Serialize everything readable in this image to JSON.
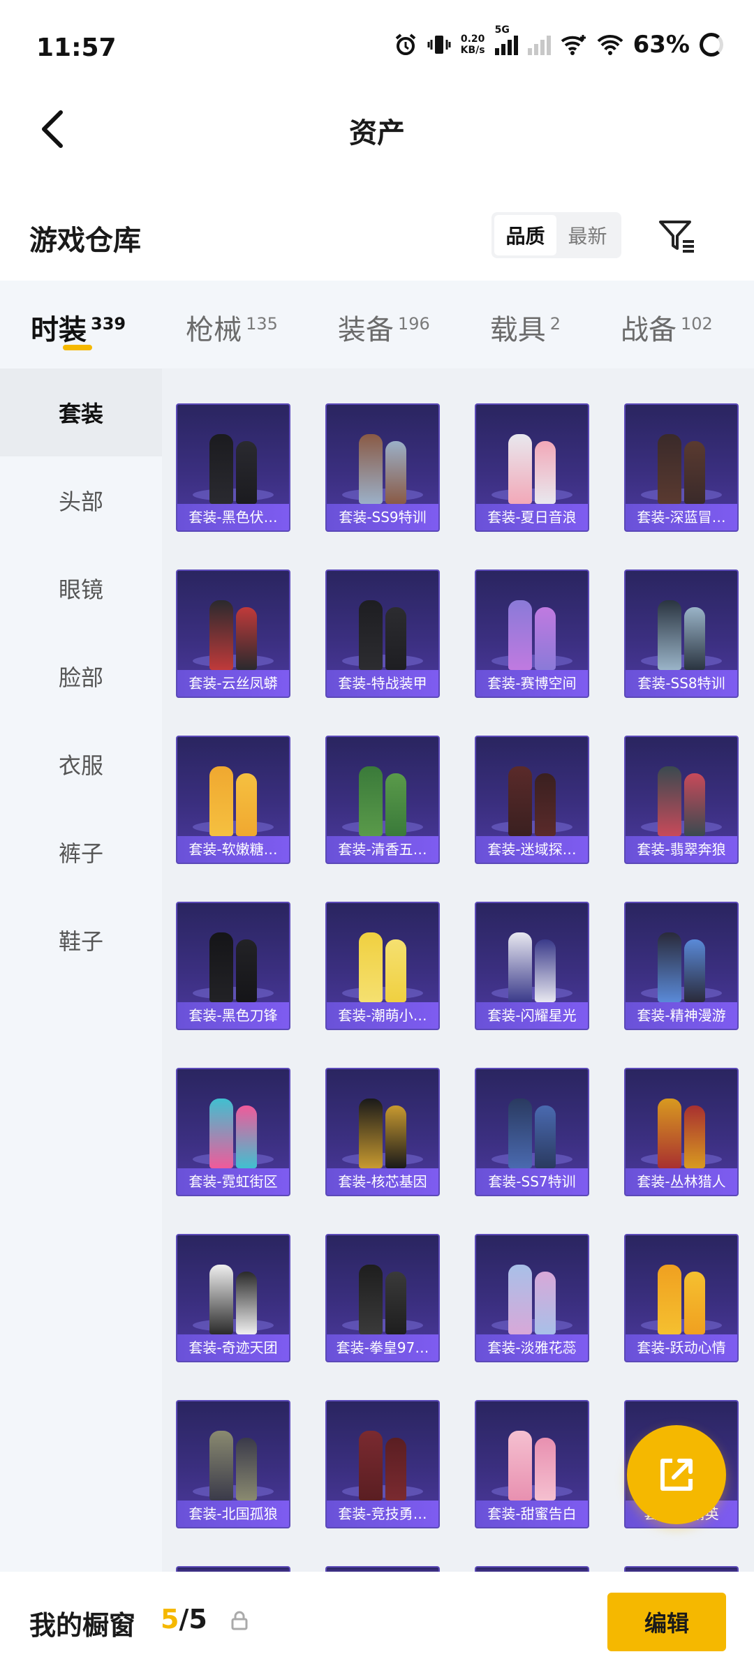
{
  "status": {
    "time": "11:57",
    "net_speed_value": "0.20",
    "net_speed_unit": "KB/s",
    "network_type": "5G",
    "battery": "63%"
  },
  "header": {
    "title": "资产"
  },
  "section": {
    "title": "游戏仓库",
    "sort_options": [
      "品质",
      "最新"
    ],
    "sort_selected": "品质"
  },
  "tabs": [
    {
      "label": "时装",
      "count": "339",
      "active": true
    },
    {
      "label": "枪械",
      "count": "135"
    },
    {
      "label": "装备",
      "count": "196"
    },
    {
      "label": "载具",
      "count": "2"
    },
    {
      "label": "战备",
      "count": "102"
    }
  ],
  "sidebar": {
    "items": [
      "套装",
      "头部",
      "眼镜",
      "脸部",
      "衣服",
      "裤子",
      "鞋子"
    ],
    "selected": "套装"
  },
  "items": [
    {
      "name": "套装-黑色伏…",
      "c1": "#1b1b1f",
      "c2": "#2a2a30"
    },
    {
      "name": "套装-SS9特训",
      "c1": "#8a5a45",
      "c2": "#9bb0c8"
    },
    {
      "name": "套装-夏日音浪",
      "c1": "#e8e8ee",
      "c2": "#f2a8b8"
    },
    {
      "name": "套装-深蓝冒…",
      "c1": "#3a2a2a",
      "c2": "#5a3a30"
    },
    {
      "name": "套装-云丝凤蟒",
      "c1": "#2a2a2e",
      "c2": "#c03a3a"
    },
    {
      "name": "套装-特战装甲",
      "c1": "#1e1e22",
      "c2": "#2c2c30"
    },
    {
      "name": "套装-赛博空间",
      "c1": "#8a7ad8",
      "c2": "#c07ae0"
    },
    {
      "name": "套装-SS8特训",
      "c1": "#2a3440",
      "c2": "#9ab4c8"
    },
    {
      "name": "套装-软嫩糖…",
      "c1": "#f0a830",
      "c2": "#f5c040"
    },
    {
      "name": "套装-清香五…",
      "c1": "#3a7a3a",
      "c2": "#5a9a4a"
    },
    {
      "name": "套装-迷域探…",
      "c1": "#5a2a2a",
      "c2": "#3a2020"
    },
    {
      "name": "套装-翡翠奔狼",
      "c1": "#3a4a50",
      "c2": "#c84a5a"
    },
    {
      "name": "套装-黑色刀锋",
      "c1": "#151518",
      "c2": "#222226"
    },
    {
      "name": "套装-潮萌小…",
      "c1": "#f0d040",
      "c2": "#f5e070"
    },
    {
      "name": "套装-闪耀星光",
      "c1": "#e8e8f0",
      "c2": "#3a3a8a"
    },
    {
      "name": "套装-精神漫游",
      "c1": "#2a2a3a",
      "c2": "#5a8ad8"
    },
    {
      "name": "套装-霓虹街区",
      "c1": "#40c0d0",
      "c2": "#f05a9a"
    },
    {
      "name": "套装-核芯基因",
      "c1": "#1a1a1a",
      "c2": "#c89a30"
    },
    {
      "name": "套装-SS7特训",
      "c1": "#2a3a60",
      "c2": "#4a6ab0"
    },
    {
      "name": "套装-丛林猎人",
      "c1": "#d89a20",
      "c2": "#a83030"
    },
    {
      "name": "套装-奇迹天团",
      "c1": "#f0f0f0",
      "c2": "#2a2a2a"
    },
    {
      "name": "套装-拳皇97…",
      "c1": "#1e1e1e",
      "c2": "#3a3a3a"
    },
    {
      "name": "套装-淡雅花蕊",
      "c1": "#a8c0e8",
      "c2": "#d8a8d8"
    },
    {
      "name": "套装-跃动心情",
      "c1": "#f0a020",
      "c2": "#f5c030"
    },
    {
      "name": "套装-北国孤狼",
      "c1": "#8a8a70",
      "c2": "#3a3a4a"
    },
    {
      "name": "套装-竞技勇…",
      "c1": "#7a2a30",
      "c2": "#5a1e22"
    },
    {
      "name": "套装-甜蜜告白",
      "c1": "#f5c0d0",
      "c2": "#e890b0"
    },
    {
      "name": "套装-…精英",
      "c1": "#3a4a3a",
      "c2": "#2a2a2a"
    }
  ],
  "bottom": {
    "showcase_label": "我的橱窗",
    "showcase_current": "5",
    "showcase_total": "/5",
    "edit_label": "编辑"
  },
  "colors": {
    "accent": "#f5b800",
    "card_bg": "#3b2f80",
    "card_label": "#7e5cf0"
  }
}
